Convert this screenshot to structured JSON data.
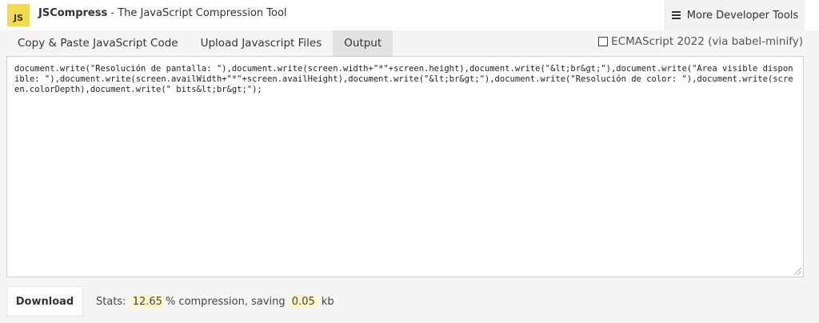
{
  "header": {
    "logo_text": "JS",
    "brand_name": "JSCompress",
    "brand_tagline": " - The JavaScript Compression Tool",
    "tools_button_label": "More Developer Tools",
    "tools_button_icon": "hamburger-menu-icon"
  },
  "tabs": [
    {
      "label": "Copy & Paste JavaScript Code",
      "active": false
    },
    {
      "label": "Upload Javascript Files",
      "active": false
    },
    {
      "label": "Output",
      "active": true
    }
  ],
  "options": {
    "ecmascript_label": "ECMAScript 2022 (via babel-minify)",
    "ecmascript_checked": false
  },
  "output": {
    "code": "document.write(\"Resolución de pantalla: \"),document.write(screen.width+\"*\"+screen.height),document.write(\"&lt;br&gt;\"),document.write(\"Area visible disponible: \"),document.write(screen.availWidth+\"*\"+screen.availHeight),document.write(\"&lt;br&gt;\"),document.write(\"Resolución de color: \"),document.write(screen.colorDepth),document.write(\" bits&lt;br&gt;\");"
  },
  "footer": {
    "download_label": "Download",
    "stats_prefix": "Stats:",
    "compression_value": "12.65",
    "compression_suffix": "% compression, saving",
    "saving_value": "0.05",
    "saving_unit": "kb"
  },
  "colors": {
    "logo_bg": "#f0db4f",
    "highlight": "#fff6c8",
    "active_tab": "#e2e2e2"
  }
}
